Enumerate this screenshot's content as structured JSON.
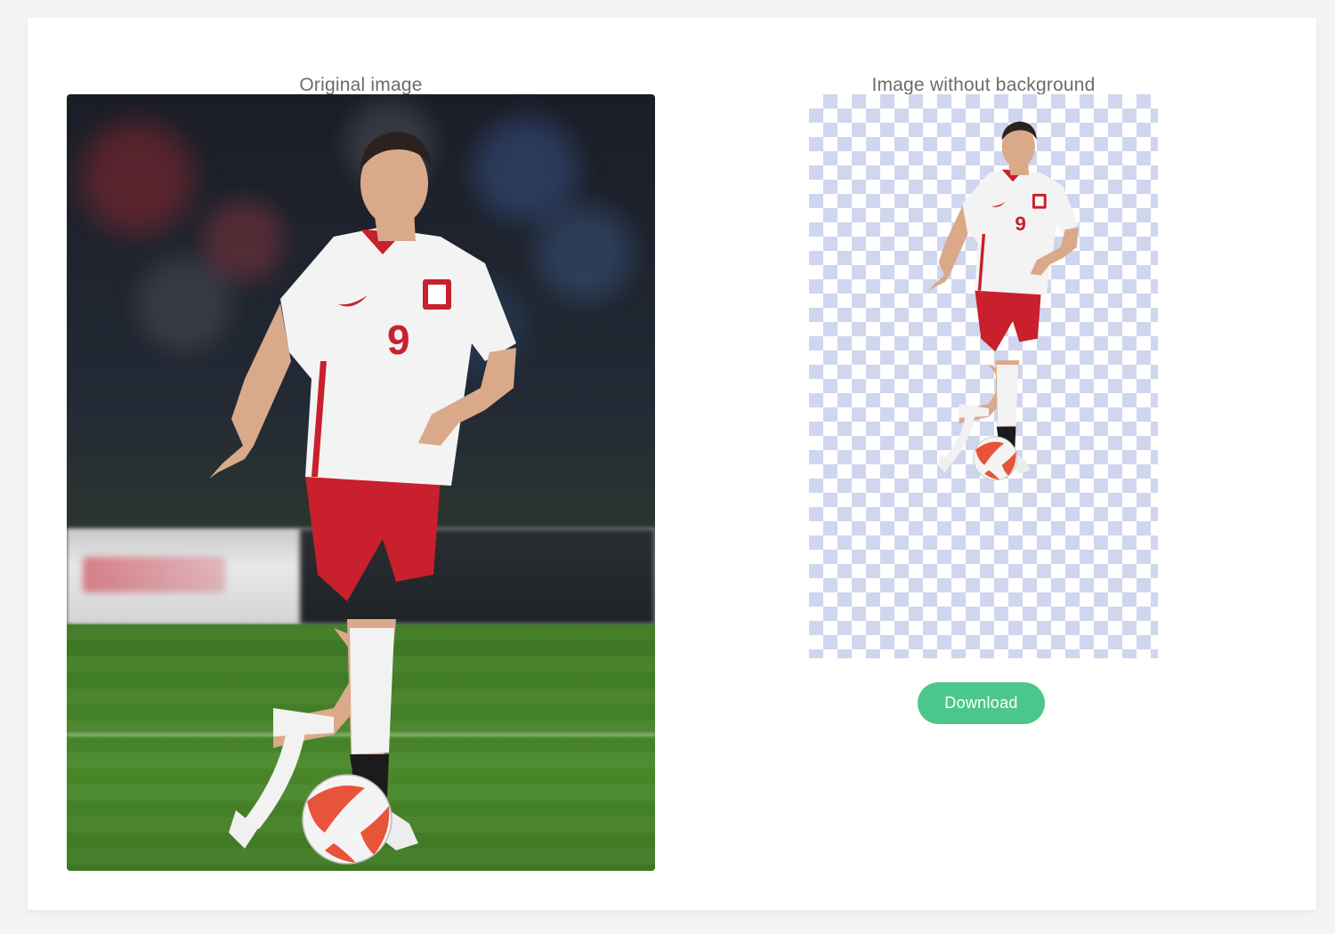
{
  "panels": {
    "original": {
      "title": "Original image"
    },
    "result": {
      "title": "Image without background"
    }
  },
  "actions": {
    "download_label": "Download"
  },
  "colors": {
    "accent": "#4cc78c",
    "checker": "#cfd6ee",
    "jersey": "#f3f3f3",
    "kit_red": "#c8202c"
  },
  "player": {
    "shirt_number": "9"
  }
}
